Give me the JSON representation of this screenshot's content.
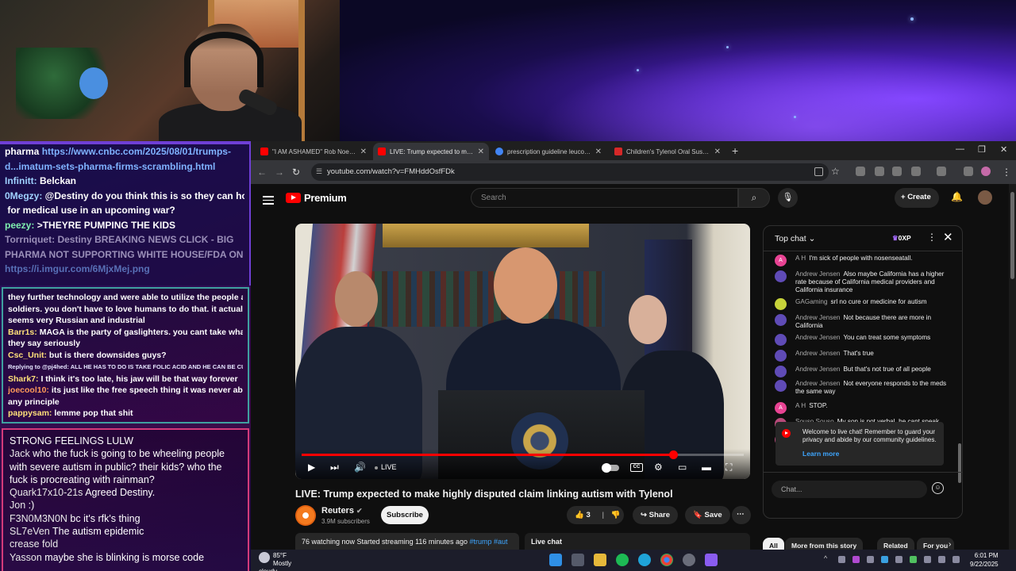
{
  "stream_chat_top": {
    "lines": [
      {
        "user": "",
        "text": "pharma ",
        "link": "https://www.cnbc.com/2025/08/01/trumps-"
      },
      {
        "user": "",
        "text": "",
        "link": "d...imatum-sets-pharma-firms-scrambling.html"
      },
      {
        "user": "Infinitt:",
        "text": " Belckan",
        "link": ""
      },
      {
        "user": "0Megzy:",
        "text": " @Destiny do you think this is so they can hoard",
        "link": ""
      },
      {
        "user": "",
        "text": "for medical use in an upcoming war?",
        "link": ""
      },
      {
        "user": "peezy:",
        "text": " >THEYRE PUMPING THE KIDS",
        "link": ""
      },
      {
        "user": "Torrniquet:",
        "text": " Destiny BREAKING NEWS CLICK - BIG",
        "link": ""
      },
      {
        "user": "",
        "text": "PHARMA NOT SUPPORTING WHITE HOUSE/FDA ON THIS",
        "link": ""
      },
      {
        "user": "",
        "text": "",
        "link": "https://i.imgur.com/6MjxMej.png"
      }
    ]
  },
  "stream_chat_mid": {
    "lines": [
      {
        "user": "",
        "text": "they further technology and were able to utilize the people as"
      },
      {
        "user": "",
        "text": "soldiers. you don't have to love humans to do that. it actually"
      },
      {
        "user": "",
        "text": "seems very Russian and industrial"
      },
      {
        "user": "Barr1s:",
        "text": " MAGA is the party of gaslighters. you cant take what"
      },
      {
        "user": "",
        "text": "they say seriously"
      },
      {
        "user": "Csc_Unit:",
        "text": " but is there downsides guys?"
      },
      {
        "user": "",
        "text": "Replying to @pj4hed: ALL HE HAS TO DO IS TAKE FOLIC ACID AND HE CAN BE CU..."
      },
      {
        "user": "Shark7:",
        "text": " I think it's too late, his jaw will be that way forever"
      },
      {
        "user": "joecool10:",
        "text": " its just like the free speech thing it was never abou"
      },
      {
        "user": "",
        "text": "any principle"
      },
      {
        "user": "pappysam:",
        "text": " lemme pop that shit"
      }
    ]
  },
  "stream_chat_bottom": {
    "lines": [
      {
        "user": "",
        "text": "STRONG FEELINGS LULW"
      },
      {
        "user": "Jack",
        "text": " who the fuck is going to be wheeling people"
      },
      {
        "user": "",
        "text": "with severe autism in public? their kids? who the"
      },
      {
        "user": "",
        "text": "fuck is procreating with rainman?"
      },
      {
        "user": "Quark17x10-21s",
        "text": " Agreed Destiny."
      },
      {
        "user": "Jon",
        "text": " :)"
      },
      {
        "user": "F3N0M3N0N",
        "text": " bc it's rfk's thing"
      },
      {
        "user": "SL7eVen",
        "text": " The autism epidemic"
      },
      {
        "user": "crease fold",
        "text": ""
      },
      {
        "user": "Yasson",
        "text": " maybe she is blinking is morse code"
      }
    ]
  },
  "browser": {
    "tabs": [
      {
        "title": "\"I AM ASHAMED\" Rob Noerr A...",
        "fav_color": "#ff0000"
      },
      {
        "title": "LIVE: Trump expected to ma...",
        "fav_color": "#ff0000"
      },
      {
        "title": "prescription guideline leucovor...",
        "fav_color": "#4285f4"
      },
      {
        "title": "Children's Tylenol Oral Suspen...",
        "fav_color": "#d62828"
      }
    ],
    "url": "youtube.com/watch?v=FMHddOsfFDk"
  },
  "youtube": {
    "logo_text": "Premium",
    "search_placeholder": "Search",
    "create_label": "Create",
    "video": {
      "live_label": "LIVE",
      "progress": 0.84,
      "title": "LIVE: Trump expected to make highly disputed claim linking autism with Tylenol"
    },
    "channel": {
      "name": "Reuters",
      "subs": "3.9M subscribers",
      "subscribe_label": "Subscribe"
    },
    "actions": {
      "likes": "3",
      "share": "Share",
      "save": "Save"
    },
    "description": {
      "text": "76 watching now  Started streaming 116 minutes ago ",
      "tags": "#trump #aut"
    },
    "live_chat_toggle": "Live chat",
    "live_chat": {
      "mode": "Top chat",
      "xp": "0XP",
      "messages": [
        {
          "initials": "A",
          "name": "A H",
          "text": "I'm sick of people with nosenseatall.",
          "color": "#e84393"
        },
        {
          "initials": "",
          "name": "Andrew Jensen",
          "text": "Also maybe California has a higher rate because of California medical providers and California insurance",
          "color": "#5f4bb6"
        },
        {
          "initials": "",
          "name": "GAGaming",
          "text": "srl no cure or medicine for autism",
          "color": "#c7d33a"
        },
        {
          "initials": "",
          "name": "Andrew Jensen",
          "text": "Not because there are more in California",
          "color": "#5f4bb6"
        },
        {
          "initials": "",
          "name": "Andrew Jensen",
          "text": "You can treat some symptoms",
          "color": "#5f4bb6"
        },
        {
          "initials": "",
          "name": "Andrew Jensen",
          "text": "That's true",
          "color": "#5f4bb6"
        },
        {
          "initials": "",
          "name": "Andrew Jensen",
          "text": "But that's not true of all people",
          "color": "#5f4bb6"
        },
        {
          "initials": "",
          "name": "Andrew Jensen",
          "text": "Not everyone responds to the meds the same way",
          "color": "#5f4bb6"
        },
        {
          "initials": "A",
          "name": "A H",
          "text": "STOP.",
          "color": "#e84393"
        },
        {
          "initials": "",
          "name": "Souso Souso",
          "text": "My son is not verbal, he cant speak",
          "color": "#b84a7a"
        },
        {
          "initials": "",
          "name": "Souso Souso",
          "text": "We should know why we do",
          "color": "#b84a7a"
        }
      ],
      "welcome": "Welcome to live chat! Remember to guard your privacy and abide by our community guidelines.",
      "learn_more": "Learn more",
      "input_placeholder": "Chat..."
    },
    "chips": [
      "All",
      "More from this story",
      "Related",
      "For you"
    ]
  },
  "taskbar": {
    "temp": "85°F",
    "condition": "Mostly cloudy",
    "time": "6:01 PM",
    "date": "9/22/2025"
  }
}
